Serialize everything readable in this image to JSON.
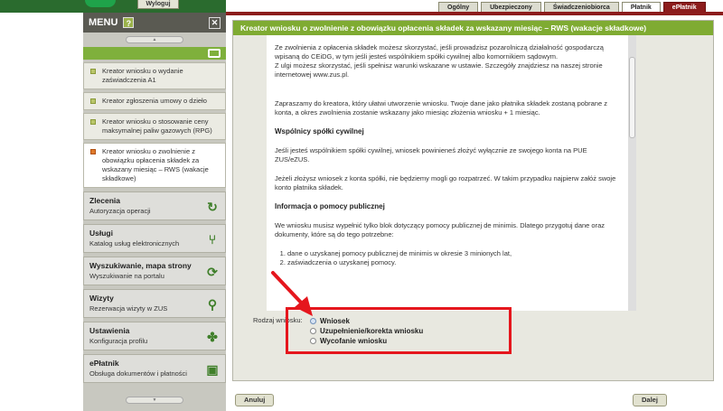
{
  "header": {
    "logout_label": "Wyloguj",
    "tabs": [
      {
        "label": "Ogólny"
      },
      {
        "label": "Ubezpieczony"
      },
      {
        "label": "Świadczeniobiorca"
      },
      {
        "label": "Płatnik"
      },
      {
        "label": "ePłatnik"
      }
    ],
    "accent_color": "#8c1c1c"
  },
  "sidebar": {
    "title": "MENU",
    "help": "?",
    "close": "✕",
    "scroll_up": "▲",
    "scroll_down": "▼",
    "subitems": [
      {
        "label": "Kreator wniosku o wydanie zaświadczenia A1"
      },
      {
        "label": "Kreator zgłoszenia umowy o dzieło"
      },
      {
        "label": "Kreator wniosku o stosowanie ceny maksymalnej paliw gazowych (RPG)"
      },
      {
        "label": "Kreator wniosku o zwolnienie z obowiązku opłacenia składek za wskazany miesiąc – RWS (wakacje składkowe)"
      }
    ],
    "sections": [
      {
        "title": "Zlecenia",
        "sub": "Autoryzacja operacji",
        "icon": "refresh-icon"
      },
      {
        "title": "Usługi",
        "sub": "Katalog usług elektronicznych",
        "icon": "tree-icon"
      },
      {
        "title": "Wyszukiwanie, mapa strony",
        "sub": "Wyszukiwanie na portalu",
        "icon": "sync-icon"
      },
      {
        "title": "Wizyty",
        "sub": "Rezerwacja wizyty w ZUS",
        "icon": "walking-icon"
      },
      {
        "title": "Ustawienia",
        "sub": "Konfiguracja profilu",
        "icon": "gear-icon"
      },
      {
        "title": "ePłatnik",
        "sub": "Obsługa dokumentów i płatności",
        "icon": "document-icon"
      }
    ]
  },
  "main": {
    "title": "Kreator wniosku o zwolnienie z obowiązku opłacenia składek za wskazany miesiąc – RWS (wakacje składkowe)",
    "p1": "Ze zwolnienia z opłacenia składek możesz skorzystać, jeśli prowadzisz pozarolniczą działalność gospodarczą wpisaną do CEiDG, w tym jeśli jesteś wspólnikiem spółki cywilnej albo komornikiem sądowym.",
    "p2": "Z ulgi możesz skorzystać, jeśli spełnisz warunki wskazane w ustawie. Szczegóły znajdziesz na naszej stronie internetowej www.zus.pl.",
    "p3": "Zapraszamy do kreatora, który ułatwi utworzenie wniosku. Twoje dane jako płatnika składek zostaną pobrane z konta, a okres zwolnienia zostanie wskazany jako miesiąc złożenia wniosku + 1 miesiąc.",
    "h1": "Wspólnicy spółki cywilnej",
    "p4": "Jeśli jesteś wspólnikiem spółki cywilnej, wniosek powinieneś złożyć wyłącznie ze swojego konta na PUE ZUS/eZUS.",
    "p5": "Jeżeli złożysz wniosek z konta spółki, nie będziemy mogli go rozpatrzeć. W takim przypadku najpierw załóż swoje konto płatnika składek.",
    "h2": "Informacja o pomocy publicznej",
    "p6": "We wniosku musisz wypełnić tylko blok dotyczący pomocy publicznej de minimis. Dlatego przygotuj dane oraz dokumenty, które są do tego potrzebne:",
    "list": [
      "dane o uzyskanej pomocy publicznej de minimis w okresie 3 minionych lat,",
      "zaświadczenia o uzyskanej pomocy."
    ],
    "radio_label": "Rodzaj wniosku:",
    "radios": [
      {
        "label": "Wniosek",
        "checked": true
      },
      {
        "label": "Uzupełnienie/korekta wniosku",
        "checked": false
      },
      {
        "label": "Wycofanie wniosku",
        "checked": false
      }
    ]
  },
  "buttons": {
    "cancel": "Anuluj",
    "next": "Dalej"
  },
  "colors": {
    "title_bar": "#7fab32",
    "highlight": "#e5161d"
  }
}
